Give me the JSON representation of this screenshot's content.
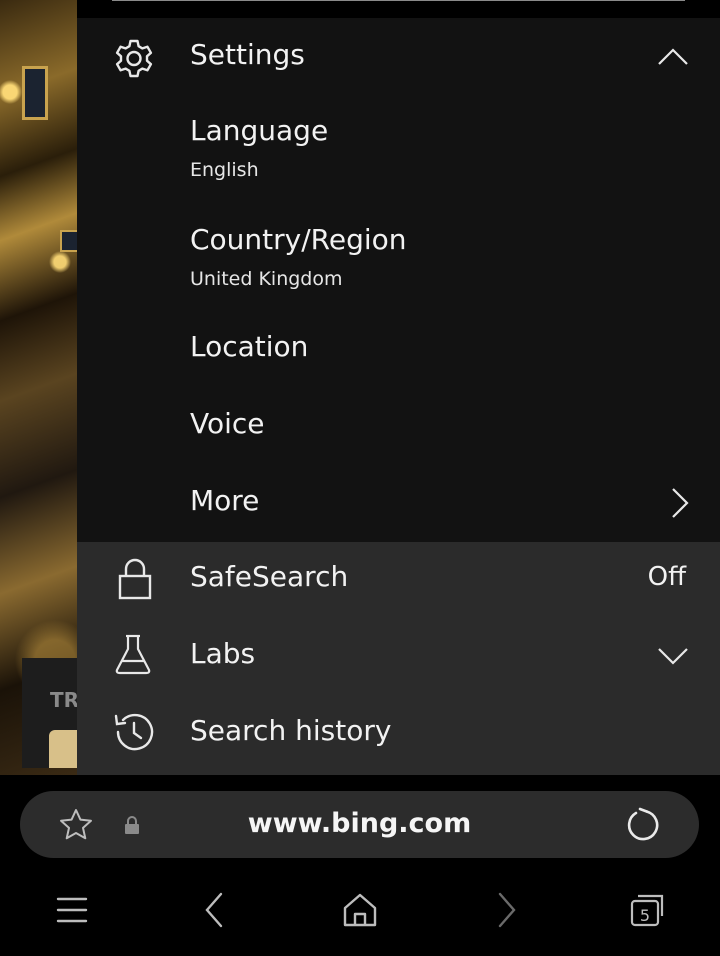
{
  "background": {
    "card_text": "TR"
  },
  "menu": {
    "settings": {
      "label": "Settings",
      "icon": "gear-icon",
      "expanded": true,
      "items": [
        {
          "label": "Language",
          "value": "English"
        },
        {
          "label": "Country/Region",
          "value": "United Kingdom"
        },
        {
          "label": "Location"
        },
        {
          "label": "Voice"
        },
        {
          "label": "More"
        }
      ]
    },
    "safesearch": {
      "label": "SafeSearch",
      "value": "Off",
      "icon": "lock-icon"
    },
    "labs": {
      "label": "Labs",
      "icon": "flask-icon",
      "expanded": false
    },
    "history": {
      "label": "Search history",
      "icon": "history-icon"
    }
  },
  "address_bar": {
    "url": "www.bing.com"
  },
  "bottom_nav": {
    "tab_count": "5"
  },
  "colors": {
    "panel_dark": "#121212",
    "panel_light": "#2b2b2b",
    "address_bar": "#2c2c2c",
    "text": "#f2f2f2"
  }
}
